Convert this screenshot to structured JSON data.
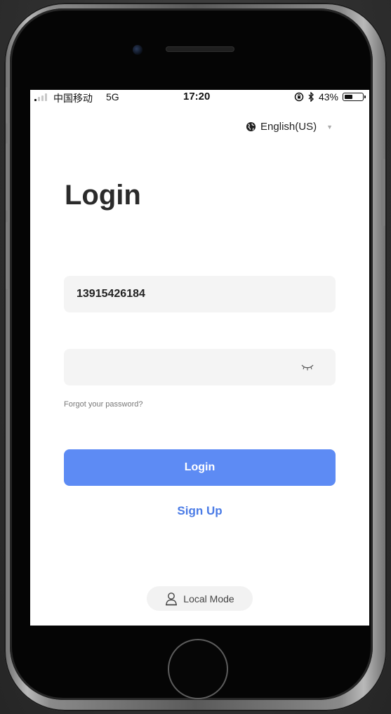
{
  "status_bar": {
    "carrier": "中国移动",
    "network": "5G",
    "time": "17:20",
    "battery_percent": "43%",
    "battery_level": 0.43,
    "icons": [
      "signal-icon",
      "orientation-lock-icon",
      "bluetooth-icon",
      "battery-icon"
    ]
  },
  "language_selector": {
    "label": "English(US)",
    "icon": "globe-icon"
  },
  "page": {
    "title": "Login"
  },
  "form": {
    "phone_value": "13915426184",
    "password_value": "",
    "password_toggle_icon": "eye-closed-icon"
  },
  "links": {
    "forgot_password": "Forgot your password?",
    "sign_up": "Sign Up"
  },
  "buttons": {
    "login": "Login",
    "local_mode": "Local Mode",
    "local_mode_icon": "person-icon"
  },
  "colors": {
    "accent": "#5d8bf4",
    "link": "#4a7be6",
    "input_background": "#f4f4f4"
  }
}
